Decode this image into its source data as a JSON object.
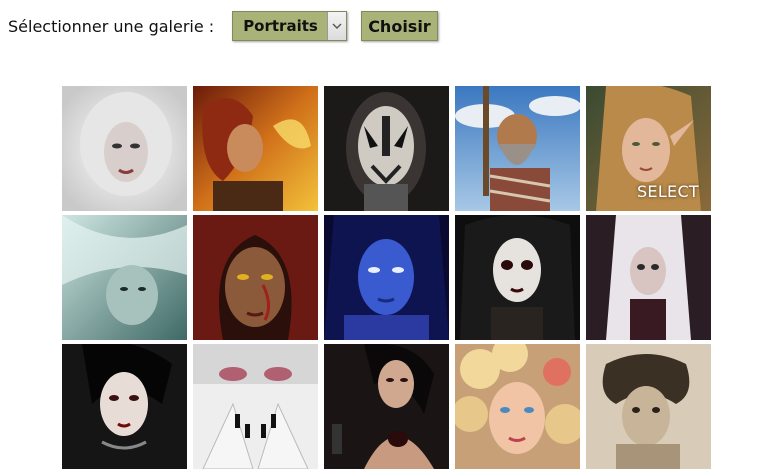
{
  "toolbar": {
    "label": "Sélectionner une galerie :",
    "gallery_select_value": "Portraits",
    "choose_button_label": "Choisir"
  },
  "gallery": {
    "hover_overlay_text": "SELECT",
    "thumbnails": [
      {
        "subject": "woman in white fur hood"
      },
      {
        "subject": "fairy with golden wings"
      },
      {
        "subject": "corpse-paint metal face"
      },
      {
        "subject": "caveman with club"
      },
      {
        "subject": "elf girl"
      },
      {
        "subject": "white-haired woman in teal"
      },
      {
        "subject": "hooded woman with red eyes"
      },
      {
        "subject": "blue-skinned woman"
      },
      {
        "subject": "pale gothic girl"
      },
      {
        "subject": "white-haired gothic doll"
      },
      {
        "subject": "gothic woman with choker"
      },
      {
        "subject": "eyes with black-nailed hands"
      },
      {
        "subject": "woman with pistol"
      },
      {
        "subject": "blonde curly-haired woman with rose"
      },
      {
        "subject": "sepia child portrait"
      }
    ]
  }
}
